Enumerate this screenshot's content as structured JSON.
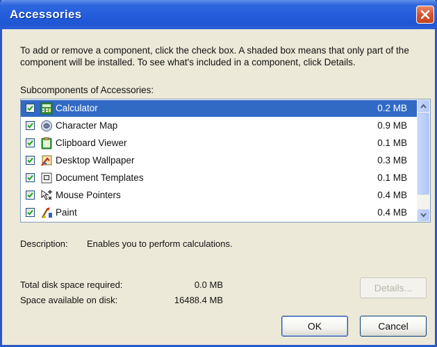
{
  "window": {
    "title": "Accessories"
  },
  "instructions": "To add or remove a component, click the check box. A shaded box means that only part of the component will be installed. To see what's included in a component, click Details.",
  "subcomponents_label": "Subcomponents of Accessories:",
  "components": [
    {
      "name": "Calculator",
      "size": "0.2 MB",
      "checked": true,
      "selected": true,
      "icon": "calculator-icon"
    },
    {
      "name": "Character Map",
      "size": "0.9 MB",
      "checked": true,
      "selected": false,
      "icon": "character-map-icon"
    },
    {
      "name": "Clipboard Viewer",
      "size": "0.1 MB",
      "checked": true,
      "selected": false,
      "icon": "clipboard-icon"
    },
    {
      "name": "Desktop Wallpaper",
      "size": "0.3 MB",
      "checked": true,
      "selected": false,
      "icon": "wallpaper-icon"
    },
    {
      "name": "Document Templates",
      "size": "0.1 MB",
      "checked": true,
      "selected": false,
      "icon": "document-template-icon"
    },
    {
      "name": "Mouse Pointers",
      "size": "0.4 MB",
      "checked": true,
      "selected": false,
      "icon": "mouse-pointer-icon"
    },
    {
      "name": "Paint",
      "size": "0.4 MB",
      "checked": true,
      "selected": false,
      "icon": "paint-icon"
    }
  ],
  "description": {
    "label": "Description:",
    "text": "Enables you to perform calculations."
  },
  "disk": {
    "total_label": "Total disk space required:",
    "total_value": "0.0 MB",
    "available_label": "Space available on disk:",
    "available_value": "16488.4 MB"
  },
  "buttons": {
    "details": "Details...",
    "ok": "OK",
    "cancel": "Cancel"
  },
  "colors": {
    "titlebar": "#245edb",
    "selection": "#316ac5",
    "dialog_bg": "#ece9d8"
  }
}
